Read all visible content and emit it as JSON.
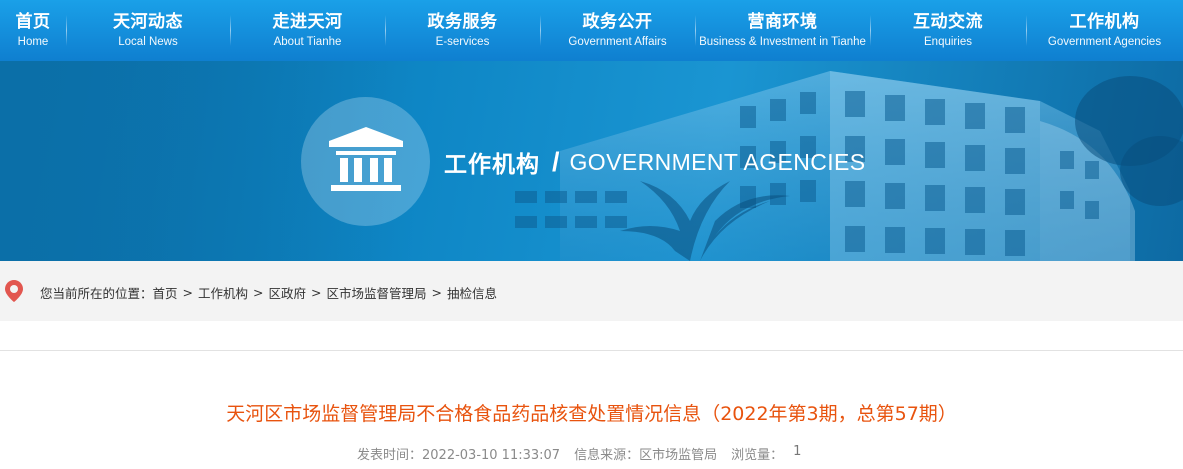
{
  "nav": {
    "items": [
      {
        "zh": "首页",
        "en": "Home"
      },
      {
        "zh": "天河动态",
        "en": "Local News"
      },
      {
        "zh": "走进天河",
        "en": "About Tianhe"
      },
      {
        "zh": "政务服务",
        "en": "E-services"
      },
      {
        "zh": "政务公开",
        "en": "Government Affairs"
      },
      {
        "zh": "营商环境",
        "en": "Business & Investment in Tianhe"
      },
      {
        "zh": "互动交流",
        "en": "Enquiries"
      },
      {
        "zh": "工作机构",
        "en": "Government Agencies"
      }
    ]
  },
  "banner": {
    "title_zh": "工作机构",
    "separator": "/",
    "title_en": "GOVERNMENT AGENCIES",
    "icon": "government-building-icon"
  },
  "breadcrumb": {
    "icon": "location-pin-icon",
    "prefix": "您当前所在的位置：",
    "separator": ">",
    "items": [
      "首页",
      "工作机构",
      "区政府",
      "区市场监督管理局",
      "抽检信息"
    ]
  },
  "article": {
    "title": "天河区市场监督管理局不合格食品药品核查处置情况信息（2022年第3期，总第57期）",
    "publish_time": "发表时间：2022-03-10 11:33:07",
    "source": "信息来源：区市场监管局",
    "views_label": "浏览量：",
    "views_value": "1"
  },
  "colors": {
    "nav_bg": "#138fdc",
    "title_accent": "#e8530e",
    "pin_red": "#e2564f",
    "breadcrumb_bg": "#f3f3f3"
  }
}
